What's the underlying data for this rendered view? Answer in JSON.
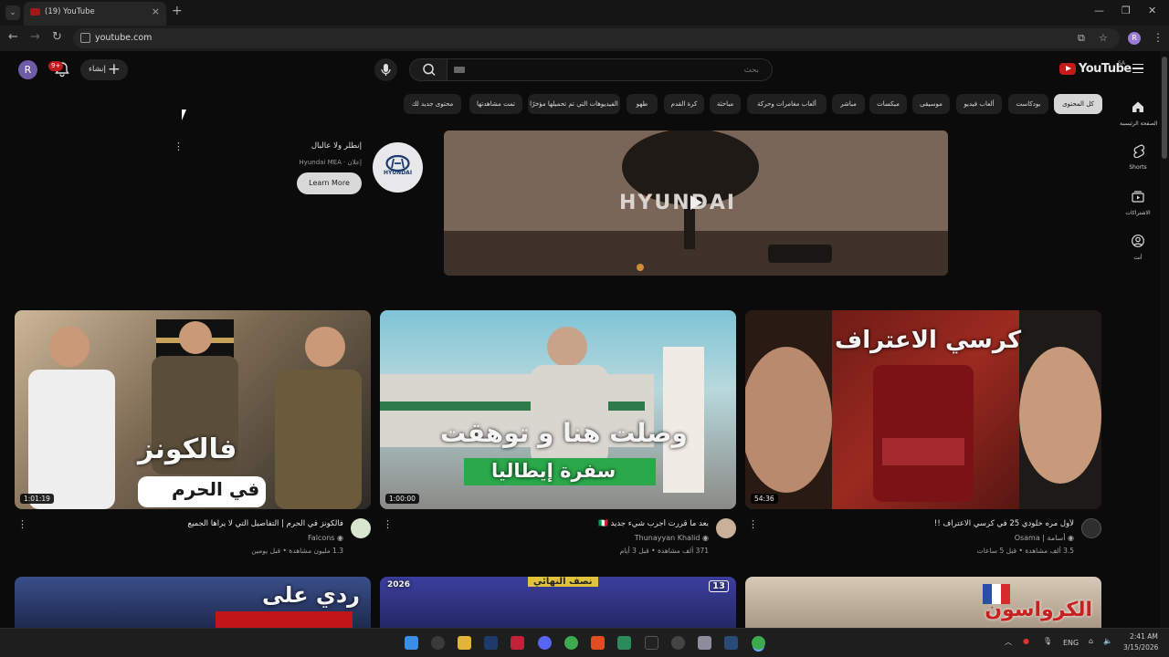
{
  "browser": {
    "tab_title": "(19) YouTube",
    "url": "youtube.com",
    "profile_initial": "R"
  },
  "masthead": {
    "avatar_initial": "R",
    "notifications_badge": "9+",
    "create_label": "إنشاء",
    "search_placeholder": "بحث",
    "logo_text": "YouTube",
    "country_code": "SA"
  },
  "guide": [
    {
      "label": "الصفحة الرئيسية",
      "icon": "home-icon"
    },
    {
      "label": "Shorts",
      "icon": "shorts-icon"
    },
    {
      "label": "الاشتراكات",
      "icon": "subscriptions-icon"
    },
    {
      "label": "أنت",
      "icon": "you-icon"
    }
  ],
  "chips": [
    "كل المحتوى",
    "بودكاست",
    "ألعاب فيديو",
    "موسيقى",
    "ميكسات",
    "مباشر",
    "ألعاب مغامرات وحركة",
    "مباحثة",
    "كرة القدم",
    "طهو",
    "الفيديوهات التي تم تحميلها مؤخرًا",
    "تمت مشاهدتها",
    "محتوى جديد لك"
  ],
  "ad": {
    "title": "إنطلر ولا عالبال",
    "sponsor_label": "إعلان",
    "advertiser": "Hyundai MEA",
    "cta": "Learn More",
    "logo_text": "HYUNDAI",
    "brand_overlay": "HYUNDAI"
  },
  "videos": [
    {
      "title": "فالكونز في الحرم | التفاصيل التي لا يراها الجميع",
      "channel": "Falcons",
      "meta": "1.3 مليون مشاهدة • قبل يومين",
      "duration": "1:01:19",
      "thumb_text_1": "فالكونز",
      "thumb_text_2": "في الحرم"
    },
    {
      "title": "بعد ما قررت أجرب شيء جديد 🇮🇹",
      "channel": "Thunayyan Khalid",
      "meta": "371 ألف مشاهدة • قبل 3 أيام",
      "duration": "1:00:00",
      "thumb_text_1": "وصلت هنا و توهقت",
      "thumb_text_2": "سفرة إيطاليا"
    },
    {
      "title": "لأول مره خلودي 25 في كرسي الاعتراف !!",
      "channel": "Osama | أسامة",
      "meta": "3.5 ألف مشاهدة • قبل 5 ساعات",
      "duration": "54:36",
      "thumb_text_1": "كرسي الاعتراف",
      "thumb_text_2": ""
    }
  ],
  "next_row": [
    {
      "thumb_text": "ردي على"
    },
    {
      "thumb_text": "نصف النهائي",
      "badge": "13",
      "year": "2026"
    },
    {
      "thumb_text": "الكرواسون"
    }
  ],
  "taskbar": {
    "language": "ENG",
    "time": "2:41 AM",
    "date": "3/15/2026"
  }
}
